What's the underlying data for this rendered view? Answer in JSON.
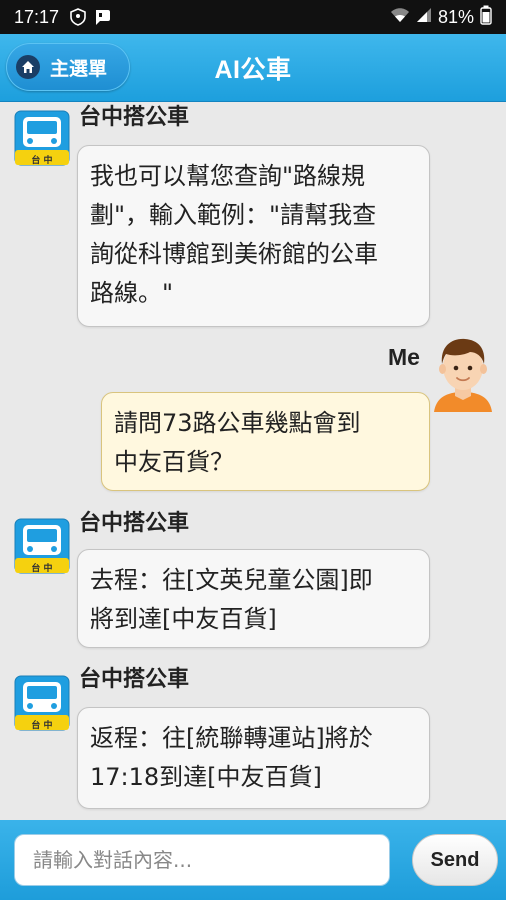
{
  "status_bar": {
    "time": "17:17",
    "battery_percent": "81%",
    "icons": [
      "shield-icon",
      "chat-notification-icon",
      "wifi-icon",
      "signal-icon",
      "battery-icon"
    ]
  },
  "header": {
    "menu_label": "主選單",
    "menu_icon": "home-icon",
    "title": "AI公車"
  },
  "messages": [
    {
      "sender": "bot",
      "name": "台中搭公車",
      "avatar_label": "台 中",
      "lines": [
        "我也可以幫您查詢\"路線規",
        "劃\"，輸入範例：\"請幫我查",
        "詢從科博館到美術館的公車",
        "路線。\""
      ]
    },
    {
      "sender": "me",
      "name": "Me",
      "lines": [
        "請問73路公車幾點會到",
        "中友百貨？"
      ]
    },
    {
      "sender": "bot",
      "name": "台中搭公車",
      "avatar_label": "台 中",
      "lines": [
        "去程：往[文英兒童公園]即",
        "將到達[中友百貨]"
      ]
    },
    {
      "sender": "bot",
      "name": "台中搭公車",
      "avatar_label": "台 中",
      "lines": [
        "返程：往[統聯轉運站]將於",
        "17:18到達[中友百貨]"
      ]
    }
  ],
  "input": {
    "placeholder": "請輸入對話內容...",
    "send_label": "Send"
  },
  "colors": {
    "header_blue": "#1d9fdd",
    "bot_bubble": "#f7f7f7",
    "user_bubble": "#fff8df",
    "bus_icon_blue": "#1f9ee0",
    "bus_icon_yellow": "#f5d10f"
  }
}
